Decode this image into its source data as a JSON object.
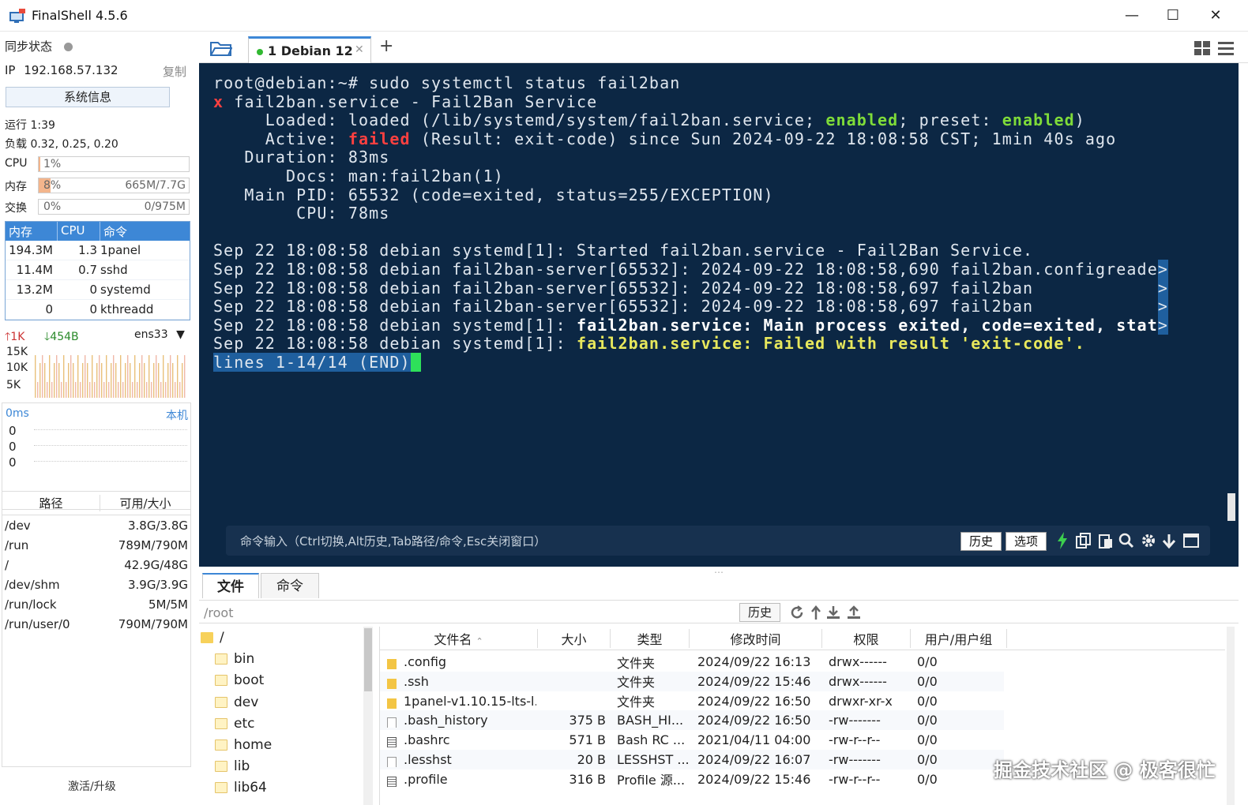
{
  "window": {
    "title": "FinalShell 4.5.6",
    "minimize": "—",
    "maximize": "☐",
    "close": "✕"
  },
  "sidebar": {
    "sync_label": "同步状态",
    "ip_label": "IP",
    "ip": "192.168.57.132",
    "copy": "复制",
    "sysinfo_button": "系统信息",
    "uptime": "运行 1:39",
    "load": "负载 0.32, 0.25, 0.20",
    "cpu": {
      "label": "CPU",
      "pct": "1%",
      "fill": 0.01
    },
    "mem": {
      "label": "内存",
      "pct": "8%",
      "amount": "665M/7.7G",
      "fill": 0.08
    },
    "swap": {
      "label": "交换",
      "pct": "0%",
      "amount": "0/975M",
      "fill": 0
    },
    "proc_headers": [
      "内存",
      "CPU",
      "命令"
    ],
    "processes": [
      {
        "mem": "194.3M",
        "cpu": "1.3",
        "cmd": "1panel"
      },
      {
        "mem": "11.4M",
        "cpu": "0.7",
        "cmd": "sshd"
      },
      {
        "mem": "13.2M",
        "cpu": "0",
        "cmd": "systemd"
      },
      {
        "mem": "0",
        "cpu": "0",
        "cmd": "kthreadd"
      }
    ],
    "net": {
      "up": "1K",
      "down": "454B",
      "iface": "ens33",
      "y_ticks": [
        "15K",
        "10K",
        "5K"
      ]
    },
    "ping": {
      "ms": "0ms",
      "host": "本机",
      "values": [
        "0",
        "0",
        "0"
      ]
    },
    "disk_headers": [
      "路径",
      "可用/大小"
    ],
    "disks": [
      {
        "path": "/dev",
        "size": "3.8G/3.8G"
      },
      {
        "path": "/run",
        "size": "789M/790M"
      },
      {
        "path": "/",
        "size": "42.9G/48G"
      },
      {
        "path": "/dev/shm",
        "size": "3.9G/3.9G"
      },
      {
        "path": "/run/lock",
        "size": "5M/5M"
      },
      {
        "path": "/run/user/0",
        "size": "790M/790M"
      }
    ],
    "activate": "激活/升级"
  },
  "tabs": [
    {
      "label": "1 Debian 12",
      "close": "✕"
    }
  ],
  "add_tab": "+",
  "terminal": {
    "prompt": "root@debian:~# sudo systemctl status fail2ban",
    "unit_mark": "x",
    "unit_line": " fail2ban.service - Fail2Ban Service",
    "loaded_pre": "     Loaded: loaded (/lib/systemd/system/fail2ban.service; ",
    "enabled1": "enabled",
    "preset": "; preset: ",
    "enabled2": "enabled",
    "close_paren": ")",
    "active_pre": "     Active: ",
    "failed": "failed",
    "active_post": " (Result: exit-code) since Sun 2024-09-22 18:08:58 CST; 1min 40s ago",
    "duration": "   Duration: 83ms",
    "docs": "       Docs: man:fail2ban(1)",
    "mainpid": "   Main PID: 65532 (code=exited, status=255/EXCEPTION)",
    "cpu": "        CPU: 78ms",
    "log1": "Sep 22 18:08:58 debian systemd[1]: Started fail2ban.service - Fail2Ban Service.",
    "log2": "Sep 22 18:08:58 debian fail2ban-server[65532]: 2024-09-22 18:08:58,690 fail2ban.configreade",
    "log3": "Sep 22 18:08:58 debian fail2ban-server[65532]: 2024-09-22 18:08:58,697 fail2ban            ",
    "log4": "Sep 22 18:08:58 debian fail2ban-server[65532]: 2024-09-22 18:08:58,697 fail2ban            ",
    "log5_pre": "Sep 22 18:08:58 debian systemd[1]: ",
    "log5_bold": "fail2ban.service: Main process exited, code=exited, stat",
    "log6_pre": "Sep 22 18:08:58 debian systemd[1]: ",
    "log6_yellow": "fail2ban.service: Failed with result 'exit-code'.",
    "more": ">",
    "status_line": "lines 1-14/14 (END)"
  },
  "cmdbar": {
    "placeholder": "命令输入（Ctrl切换,Alt历史,Tab路径/命令,Esc关闭窗口）",
    "history": "历史",
    "options": "选项"
  },
  "files": {
    "tab_files": "文件",
    "tab_commands": "命令",
    "path": "/root",
    "history": "历史",
    "tree": [
      "/",
      "bin",
      "boot",
      "dev",
      "etc",
      "home",
      "lib",
      "lib64"
    ],
    "headers": [
      "文件名",
      "大小",
      "类型",
      "修改时间",
      "权限",
      "用户/用户组"
    ],
    "rows": [
      {
        "name": ".config",
        "size": "",
        "type": "文件夹",
        "mtime": "2024/09/22 16:13",
        "perm": "drwx------",
        "owner": "0/0",
        "kind": "folder"
      },
      {
        "name": ".ssh",
        "size": "",
        "type": "文件夹",
        "mtime": "2024/09/22 15:46",
        "perm": "drwx------",
        "owner": "0/0",
        "kind": "folder"
      },
      {
        "name": "1panel-v1.10.15-lts-l...",
        "size": "",
        "type": "文件夹",
        "mtime": "2024/09/22 16:50",
        "perm": "drwxr-xr-x",
        "owner": "0/0",
        "kind": "folder"
      },
      {
        "name": ".bash_history",
        "size": "375 B",
        "type": "BASH_HI...",
        "mtime": "2024/09/22 16:50",
        "perm": "-rw-------",
        "owner": "0/0",
        "kind": "file"
      },
      {
        "name": ".bashrc",
        "size": "571 B",
        "type": "Bash RC ...",
        "mtime": "2021/04/11 04:00",
        "perm": "-rw-r--r--",
        "owner": "0/0",
        "kind": "doc"
      },
      {
        "name": ".lesshst",
        "size": "20 B",
        "type": "LESSHST ...",
        "mtime": "2024/09/22 16:07",
        "perm": "-rw-------",
        "owner": "0/0",
        "kind": "file"
      },
      {
        "name": ".profile",
        "size": "316 B",
        "type": "Profile 源...",
        "mtime": "2024/09/22 15:46",
        "perm": "-rw-r--r--",
        "owner": "0/0",
        "kind": "doc"
      }
    ]
  },
  "watermark": "掘金技术社区 @ 极客很忙"
}
